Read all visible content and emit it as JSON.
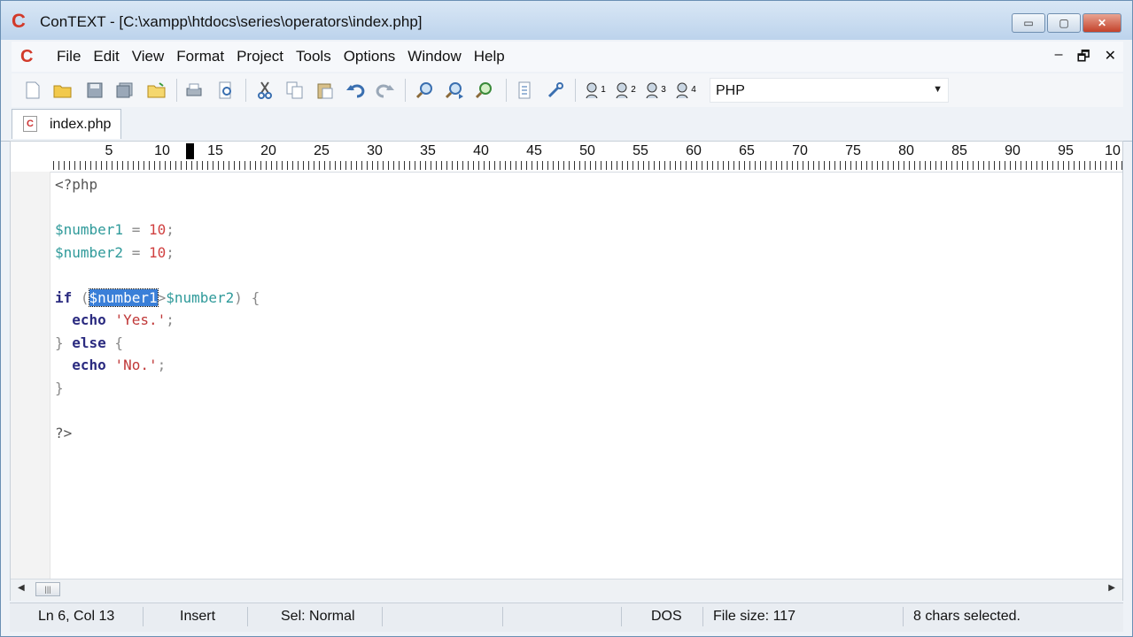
{
  "window": {
    "title": "ConTEXT - [C:\\xampp\\htdocs\\series\\operators\\index.php]",
    "logo": "C",
    "min_glyph": "▭",
    "max_glyph": "▢",
    "close_glyph": "✕"
  },
  "menu": {
    "items": [
      "File",
      "Edit",
      "View",
      "Format",
      "Project",
      "Tools",
      "Options",
      "Window",
      "Help"
    ],
    "mdi_min": "–",
    "mdi_restore": "🗗",
    "mdi_close": "✕"
  },
  "toolbar": {
    "language": "PHP",
    "user_tools": [
      "1",
      "2",
      "3",
      "4"
    ]
  },
  "tabs": [
    {
      "label": "index.php"
    }
  ],
  "ruler": {
    "numbers": [
      "5",
      "10",
      "15",
      "20",
      "25",
      "30",
      "35",
      "40",
      "45",
      "50",
      "55",
      "60",
      "65",
      "70",
      "75",
      "80",
      "85",
      "90",
      "95",
      "10"
    ]
  },
  "code": {
    "open_tag": "<?php",
    "l3_var": "$number1",
    "l3_eq": " = ",
    "l3_num": "10",
    "l3_semi": ";",
    "l4_var": "$number2",
    "l4_eq": " = ",
    "l4_num": "10",
    "l4_semi": ";",
    "l6_if": "if",
    "l6_paren_open": " (",
    "l6_selected": "$number1",
    "l6_op": ">",
    "l6_var2": "$number2",
    "l6_paren_close": ") {",
    "l7_echo": "echo",
    "l7_str": "'Yes.'",
    "l7_semi": ";",
    "l8_brace": "} ",
    "l8_else": "else",
    "l8_brace2": " {",
    "l9_echo": "echo",
    "l9_str": "'No.'",
    "l9_semi": ";",
    "l10_brace": "}",
    "close_tag": "?>"
  },
  "scrollbar": {
    "left": "◀",
    "thumb": "|||",
    "right": "▶"
  },
  "status": {
    "position": "Ln 6, Col 13",
    "mode": "Insert",
    "sel_mode": "Sel: Normal",
    "line_ending": "DOS",
    "file_size": "File size: 117",
    "selection": "8 chars selected."
  }
}
